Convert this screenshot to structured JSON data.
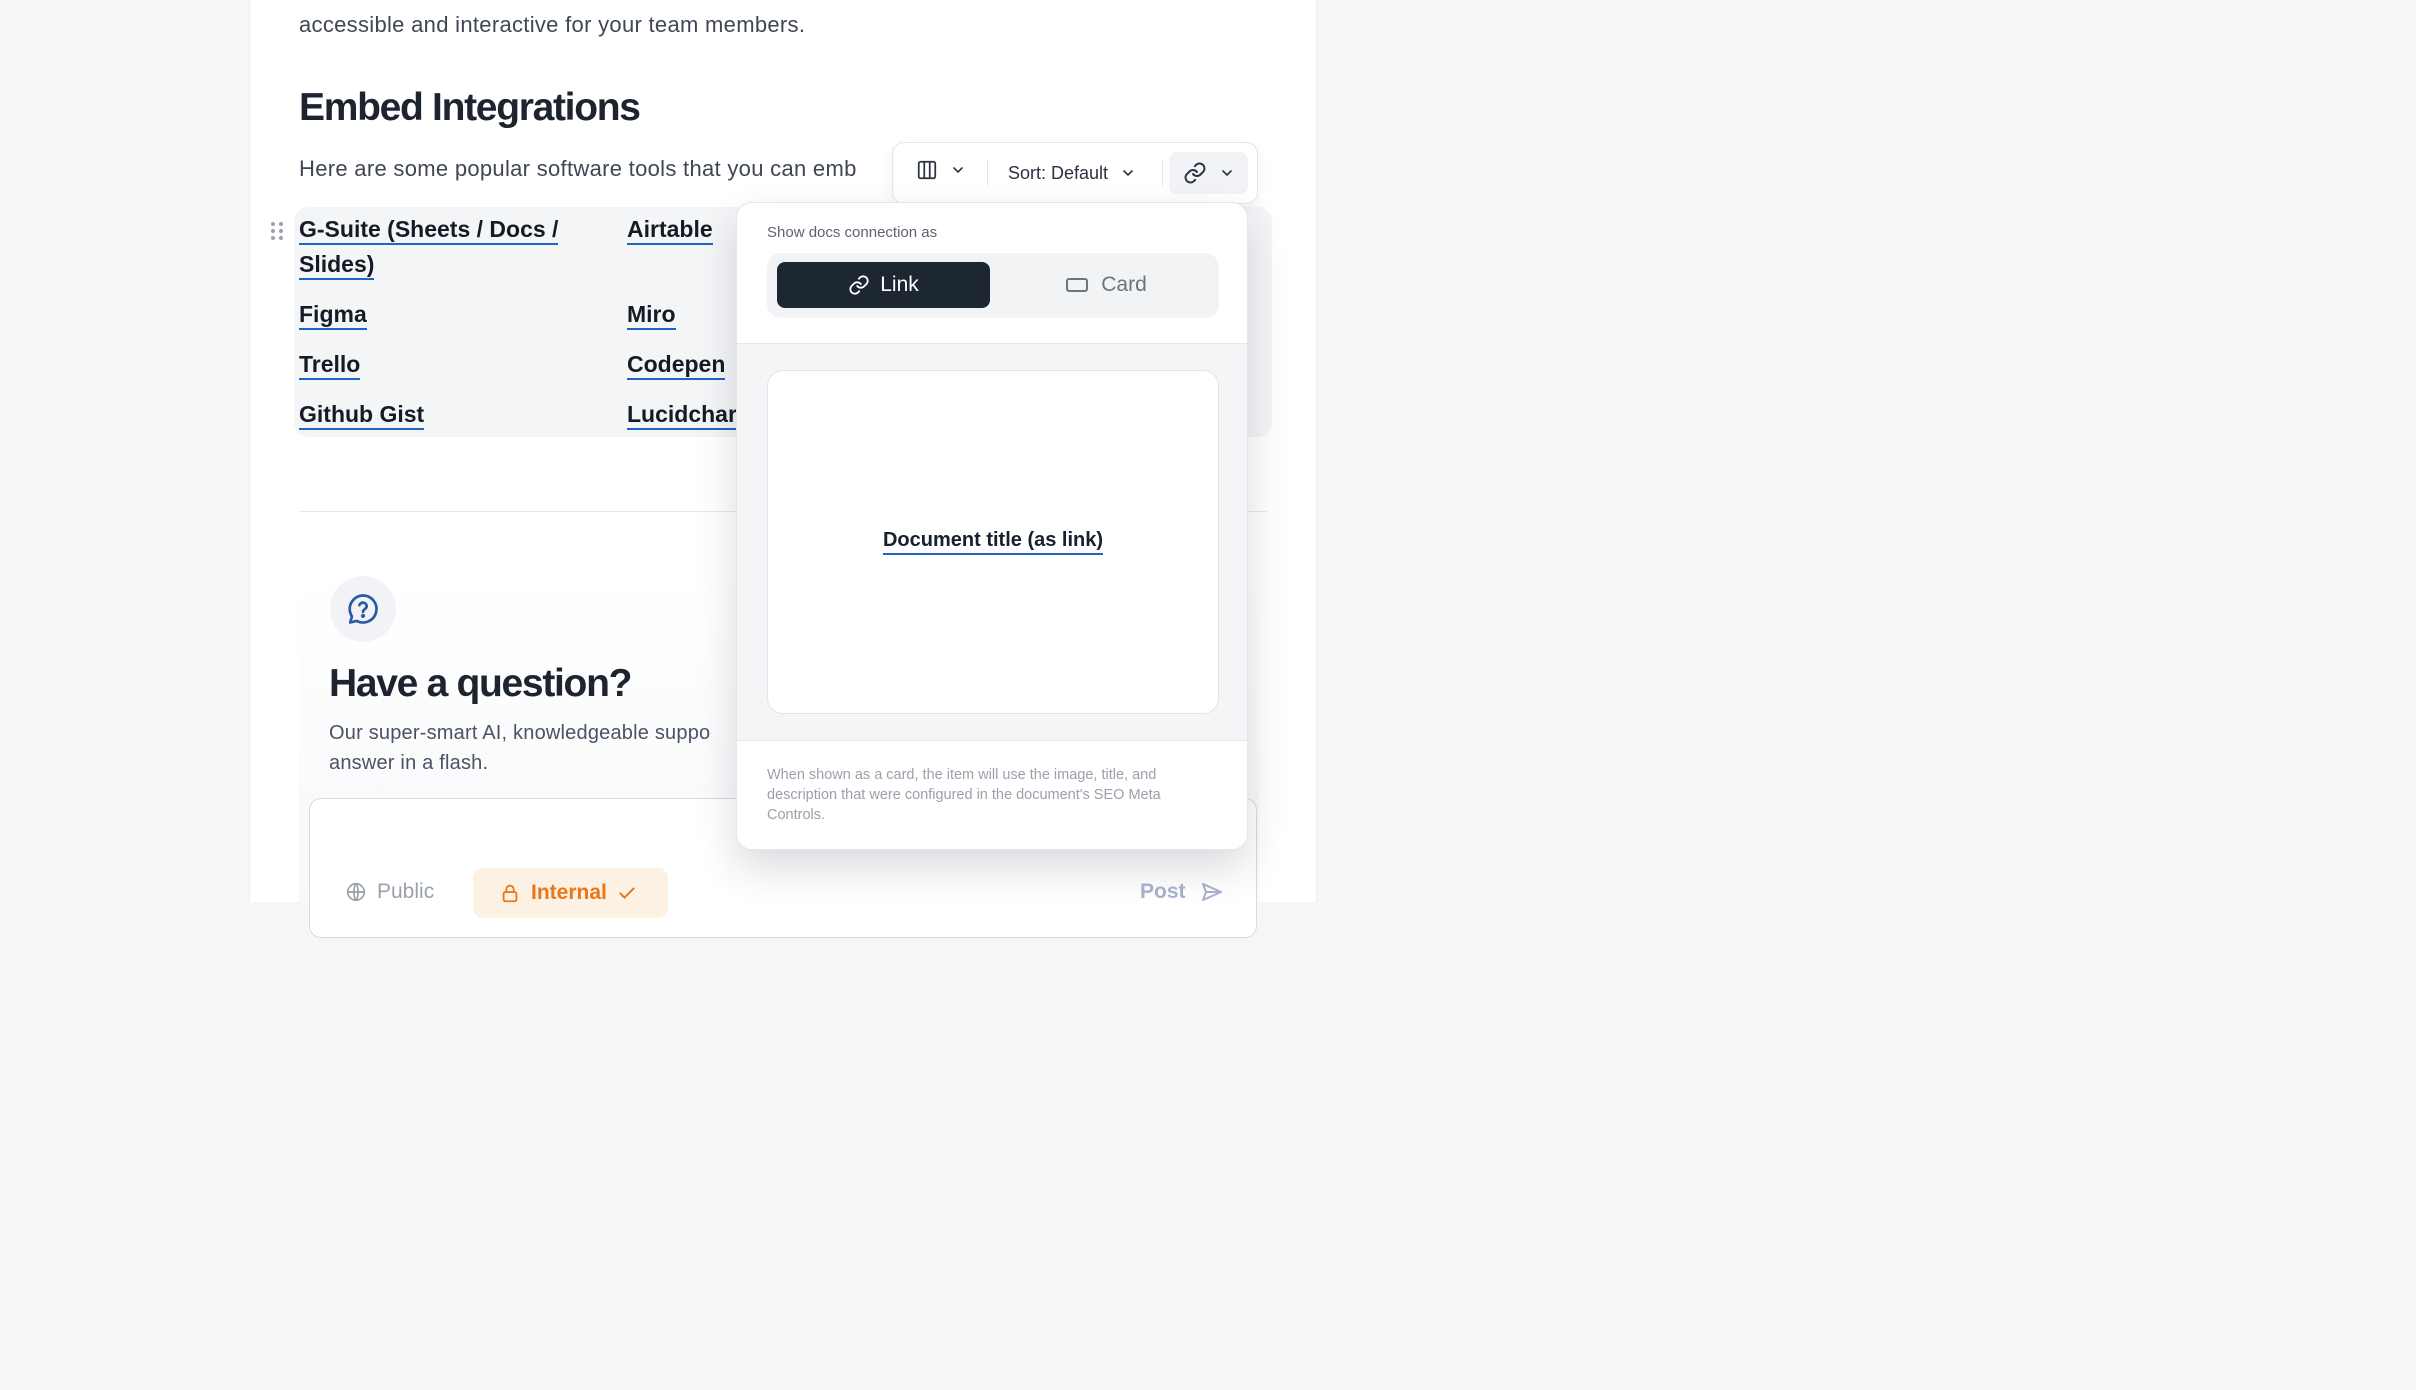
{
  "article": {
    "intro_tail": "accessible and interactive for your team members.",
    "heading": "Embed Integrations",
    "lead": "Here are some popular software tools that you can emb",
    "integrations": [
      [
        "G-Suite (Sheets / Docs /",
        "Slides)"
      ],
      [
        "Airtable"
      ],
      [
        "Figma"
      ],
      [
        "Miro"
      ],
      [
        "Trello"
      ],
      [
        "Codepen"
      ],
      [
        "Github Gist"
      ],
      [
        "Lucidchar"
      ]
    ]
  },
  "question": {
    "title": "Have a question?",
    "description_line1": "Our super-smart AI, knowledgeable suppo",
    "description_line2": "answer in a flash.",
    "visibility_public": "Public",
    "visibility_internal": "Internal",
    "post_label": "Post"
  },
  "toolbar": {
    "sort_label": "Sort: Default",
    "columns_icon": "columns-icon",
    "link_icon": "link-icon"
  },
  "popover": {
    "label": "Show docs connection as",
    "options": [
      "Link",
      "Card"
    ],
    "selected": "Link",
    "preview_title": "Document title (as link)",
    "footnote": "When shown as a card, the item will use the image, title, and description that were configured in the document's SEO Meta Controls."
  },
  "colors": {
    "link_underline": "#1f64c4",
    "selected_segment": "#1d2732",
    "internal_accent": "#e9771a",
    "post_accent": "#a8b4cf"
  }
}
